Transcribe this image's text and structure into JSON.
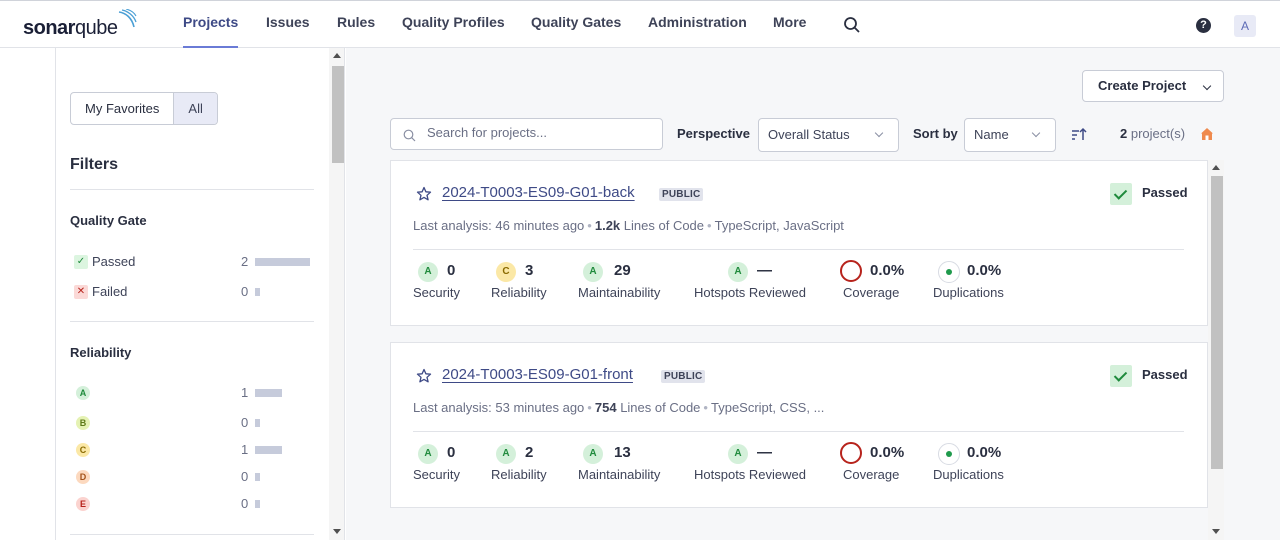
{
  "app": {
    "logo_text_bold": "sonar",
    "logo_text_light": "qube"
  },
  "nav": {
    "items": [
      {
        "label": "Projects",
        "active": true
      },
      {
        "label": "Issues"
      },
      {
        "label": "Rules"
      },
      {
        "label": "Quality Profiles"
      },
      {
        "label": "Quality Gates"
      },
      {
        "label": "Administration"
      },
      {
        "label": "More"
      }
    ],
    "help_icon": "?",
    "avatar_letter": "A"
  },
  "sidebar": {
    "toggle": {
      "favorites": "My Favorites",
      "all": "All",
      "selected": "All"
    },
    "filters_title": "Filters",
    "quality_gate": {
      "title": "Quality Gate",
      "items": [
        {
          "label": "Passed",
          "count": "2",
          "fraction": 1.0
        },
        {
          "label": "Failed",
          "count": "0",
          "fraction": 0.0
        }
      ]
    },
    "reliability": {
      "title": "Reliability",
      "items": [
        {
          "grade": "A",
          "count": "1",
          "fraction": 0.5
        },
        {
          "grade": "B",
          "count": "0",
          "fraction": 0.0
        },
        {
          "grade": "C",
          "count": "1",
          "fraction": 0.5
        },
        {
          "grade": "D",
          "count": "0",
          "fraction": 0.0
        },
        {
          "grade": "E",
          "count": "0",
          "fraction": 0.0
        }
      ]
    }
  },
  "toolbar": {
    "create_project": "Create Project",
    "search_placeholder": "Search for projects...",
    "perspective_label": "Perspective",
    "perspective_value": "Overall Status",
    "sort_label": "Sort by",
    "sort_value": "Name",
    "count_number": "2",
    "count_suffix": "project(s)"
  },
  "projects": [
    {
      "name": "2024-T0003-ES09-G01-back",
      "visibility": "PUBLIC",
      "status": "Passed",
      "analysis_label": "Last analysis:",
      "analysis_time": "46 minutes ago",
      "loc": "1.2k",
      "loc_label": "Lines of Code",
      "languages": "TypeScript, JavaScript",
      "metrics": {
        "security": {
          "grade": "A",
          "value": "0",
          "label": "Security"
        },
        "reliability": {
          "grade": "C",
          "value": "3",
          "label": "Reliability"
        },
        "maintainability": {
          "grade": "A",
          "value": "29",
          "label": "Maintainability"
        },
        "hotspots": {
          "grade": "A",
          "value": "—",
          "label": "Hotspots Reviewed"
        },
        "coverage": {
          "value": "0.0%",
          "label": "Coverage"
        },
        "duplications": {
          "value": "0.0%",
          "label": "Duplications"
        }
      }
    },
    {
      "name": "2024-T0003-ES09-G01-front",
      "visibility": "PUBLIC",
      "status": "Passed",
      "analysis_label": "Last analysis:",
      "analysis_time": "53 minutes ago",
      "loc": "754",
      "loc_label": "Lines of Code",
      "languages": "TypeScript, CSS, ...",
      "metrics": {
        "security": {
          "grade": "A",
          "value": "0",
          "label": "Security"
        },
        "reliability": {
          "grade": "A",
          "value": "2",
          "label": "Reliability"
        },
        "maintainability": {
          "grade": "A",
          "value": "13",
          "label": "Maintainability"
        },
        "hotspots": {
          "grade": "A",
          "value": "—",
          "label": "Hotspots Reviewed"
        },
        "coverage": {
          "value": "0.0%",
          "label": "Coverage"
        },
        "duplications": {
          "value": "0.0%",
          "label": "Duplications"
        }
      }
    }
  ],
  "colors": {
    "accent": "#3e4a86",
    "grade_A_bg": "#d4f0da",
    "grade_A_fg": "#1f8a3c",
    "grade_B_bg": "#e5f2b3",
    "grade_B_fg": "#5e7a1a",
    "grade_C_bg": "#fbe8a6",
    "grade_C_fg": "#8a6a00",
    "grade_D_bg": "#fcd9bf",
    "grade_D_fg": "#a3521a",
    "grade_E_bg": "#fbd3cf",
    "grade_E_fg": "#b7231c"
  }
}
